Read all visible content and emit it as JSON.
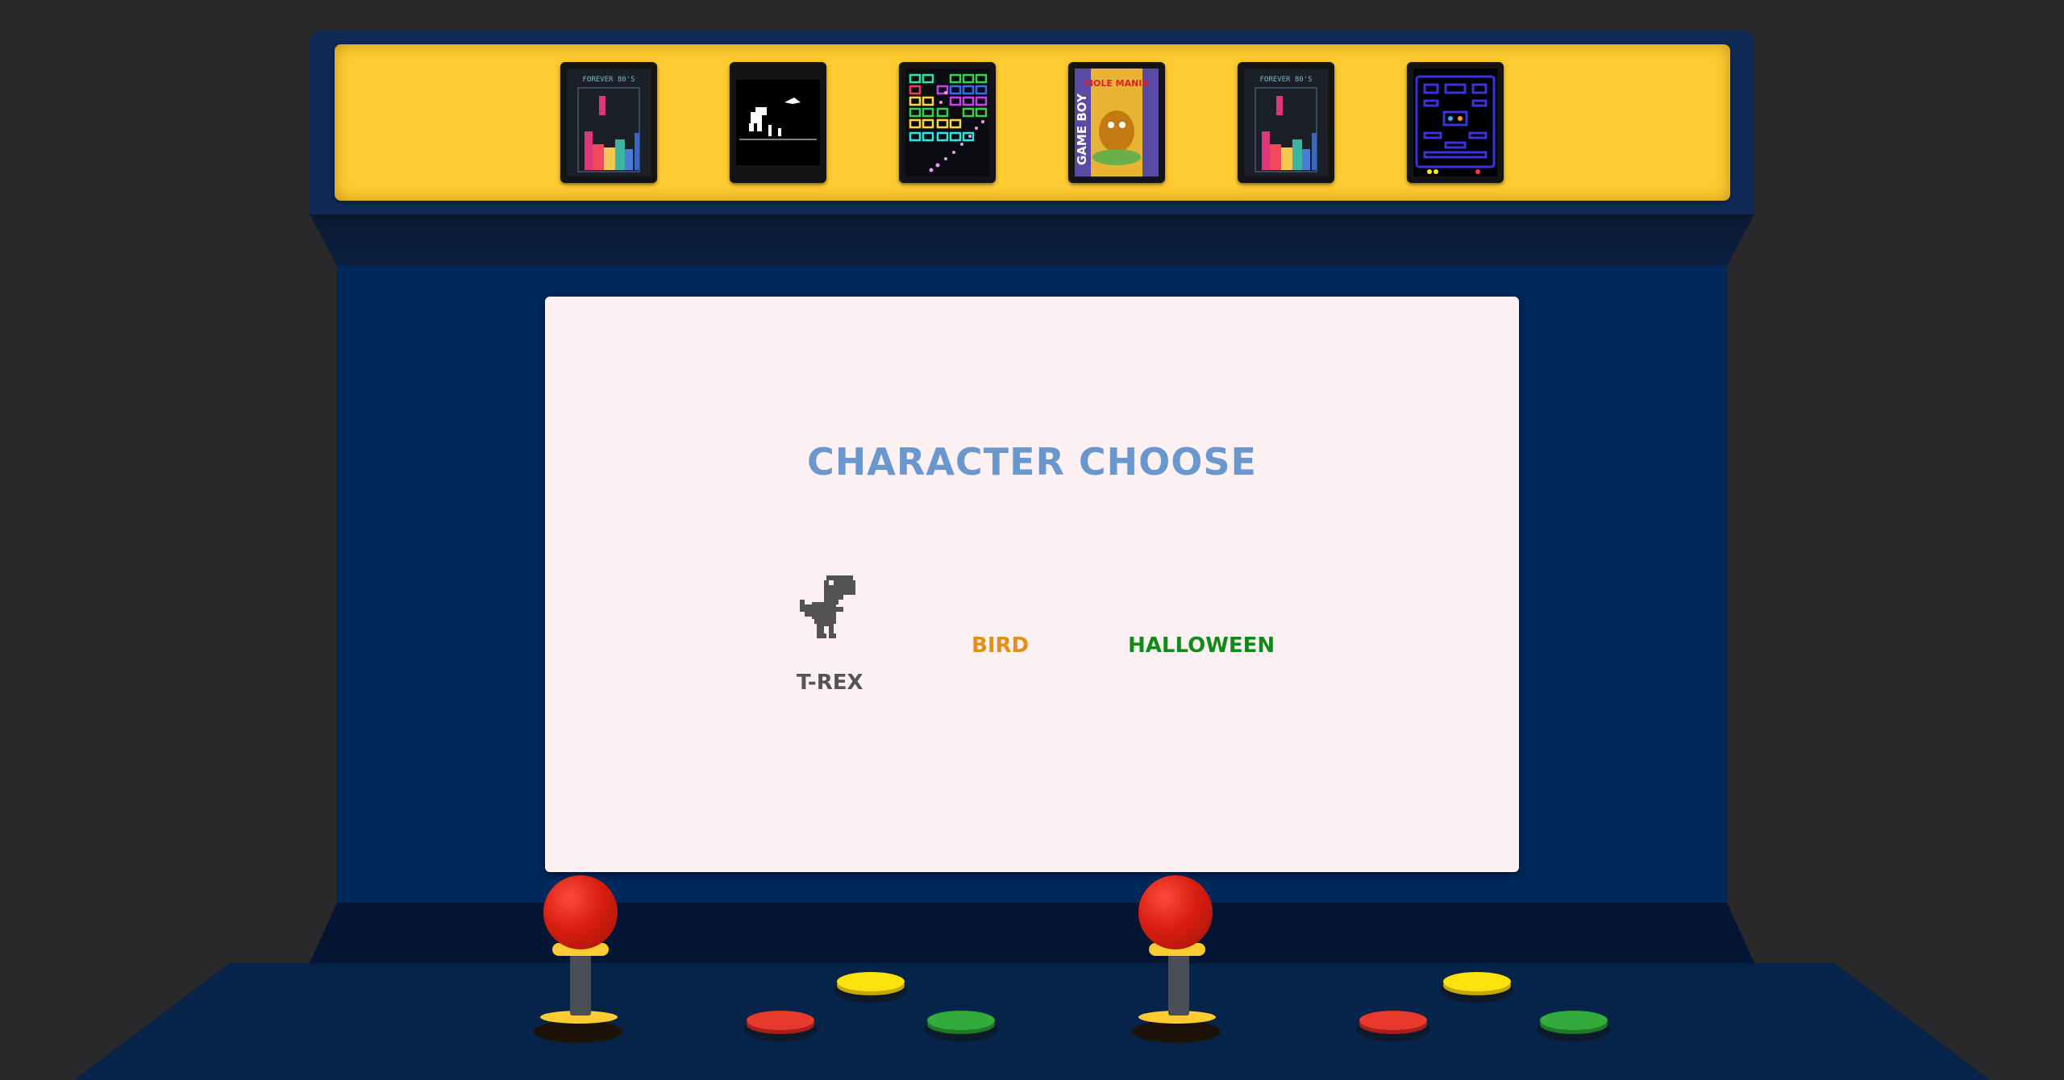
{
  "marquee": {
    "cartridges": [
      {
        "name": "tetris",
        "caption": "FOREVER 80'S"
      },
      {
        "name": "dino-runner",
        "caption": ""
      },
      {
        "name": "brick-breaker",
        "caption": ""
      },
      {
        "name": "mole-mania",
        "caption": "MOLE MANIA",
        "brand": "GAME BOY"
      },
      {
        "name": "tetris-2",
        "caption": "FOREVER 80'S"
      },
      {
        "name": "pac-man",
        "caption": ""
      }
    ]
  },
  "screen": {
    "title": "CHARACTER CHOOSE",
    "characters": [
      {
        "label": "T-REX",
        "color": "#555555",
        "selected": true
      },
      {
        "label": "BIRD",
        "color": "#e58f12"
      },
      {
        "label": "HALLOWEEN",
        "color": "#128a18"
      }
    ]
  },
  "colors": {
    "background": "#29292b",
    "cabinet": "#00285a",
    "marquee": "#fecb30",
    "screen": "#fdf1f4",
    "title": "#6a97ce"
  },
  "controls": {
    "players": [
      {
        "joystick": "red-joystick",
        "buttons": [
          "red",
          "yellow",
          "green"
        ]
      },
      {
        "joystick": "red-joystick",
        "buttons": [
          "red",
          "yellow",
          "green"
        ]
      }
    ]
  }
}
